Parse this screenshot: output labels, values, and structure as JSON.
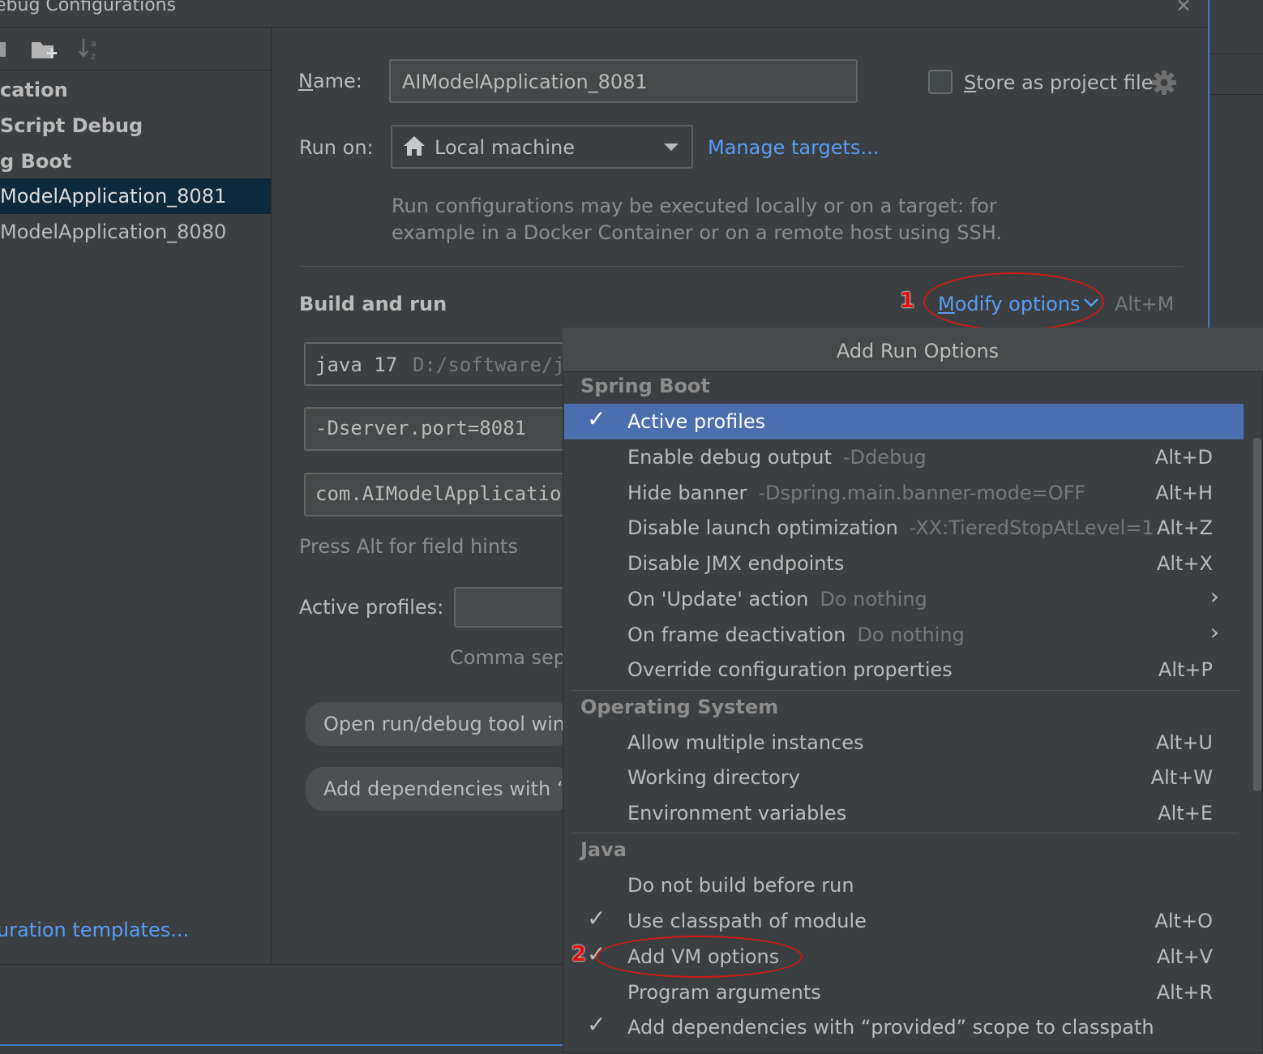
{
  "window": {
    "title": "ebug Configurations",
    "close_glyph": "×"
  },
  "left": {
    "toolbar_icons": [
      "save-icon",
      "new-folder-icon",
      "sort-alpha-icon"
    ],
    "tree": [
      {
        "label": "cation",
        "bold": true
      },
      {
        "label": "Script Debug",
        "bold": true
      },
      {
        "label": "g Boot",
        "bold": true
      },
      {
        "label": "ModelApplication_8081",
        "selected": true
      },
      {
        "label": "ModelApplication_8080"
      }
    ],
    "templates_link": "uration templates..."
  },
  "form": {
    "name_label_u": "N",
    "name_label_rest": "ame:",
    "name_value": "AIModelApplication_8081",
    "store_label_u": "S",
    "store_label_rest": "tore as project file",
    "run_on_label": "Run on:",
    "run_on_value": "Local machine",
    "manage_targets": "Manage targets...",
    "info_line1": "Run configurations may be executed locally or on a target: for",
    "info_line2": "example in a Docker Container or on a remote host using SSH.",
    "build_run_title": "Build and run",
    "modify_u": "M",
    "modify_rest": "odify options",
    "modify_shortcut": "Alt+M",
    "jre_prefix": "java 17",
    "jre_path": "D:/software/j",
    "vm_options": "-Dserver.port=8081",
    "main_class": "com.AIModelApplicatio",
    "field_hint": "Press Alt for field hints",
    "active_profiles_label": "Active profiles:",
    "comma_hint": "Comma sepa",
    "btn_open_tool": "Open run/debug tool win",
    "btn_add_deps": "Add dependencies with “p"
  },
  "annotations": {
    "marker1": "1",
    "marker2": "2"
  },
  "popup": {
    "title": "Add Run Options",
    "sections": [
      {
        "name": "Spring Boot",
        "items": [
          {
            "label": "Active profiles",
            "checked": true,
            "selected": true
          },
          {
            "label": "Enable debug output",
            "sub": "-Ddebug",
            "shortcut": "Alt+D"
          },
          {
            "label": "Hide banner",
            "sub": "-Dspring.main.banner-mode=OFF",
            "shortcut": "Alt+H"
          },
          {
            "label": "Disable launch optimization",
            "sub": "-XX:TieredStopAtLevel=1",
            "shortcut": "Alt+Z"
          },
          {
            "label": "Disable JMX endpoints",
            "shortcut": "Alt+X"
          },
          {
            "label": "On 'Update' action",
            "sub": "Do nothing",
            "submenu": true
          },
          {
            "label": "On frame deactivation",
            "sub": "Do nothing",
            "submenu": true
          },
          {
            "label": "Override configuration properties",
            "shortcut": "Alt+P"
          }
        ]
      },
      {
        "name": "Operating System",
        "items": [
          {
            "label": "Allow multiple instances",
            "shortcut": "Alt+U"
          },
          {
            "label": "Working directory",
            "shortcut": "Alt+W"
          },
          {
            "label": "Environment variables",
            "shortcut": "Alt+E"
          }
        ]
      },
      {
        "name": "Java",
        "items": [
          {
            "label": "Do not build before run"
          },
          {
            "label": "Use classpath of module",
            "checked": true,
            "shortcut": "Alt+O"
          },
          {
            "label": "Add VM options",
            "checked": true,
            "shortcut": "Alt+V"
          },
          {
            "label": "Program arguments",
            "shortcut": "Alt+R"
          },
          {
            "label": "Add dependencies with “provided” scope to classpath",
            "checked": true
          }
        ]
      }
    ]
  },
  "colors": {
    "background": "#3c3f41",
    "selection": "#4b6eaf",
    "tree_selection": "#0d293e",
    "link": "#589df6",
    "annotation": "#d01818"
  }
}
